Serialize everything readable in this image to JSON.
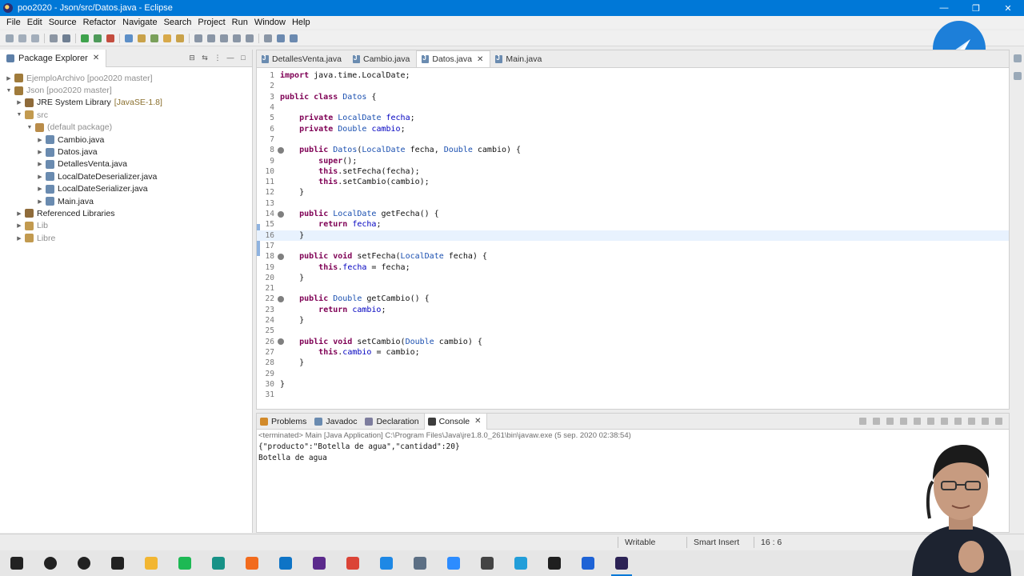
{
  "window": {
    "title": "poo2020 - Json/src/Datos.java - Eclipse",
    "min": "—",
    "restore": "❐",
    "close": "✕"
  },
  "menu": [
    "File",
    "Edit",
    "Source",
    "Refactor",
    "Navigate",
    "Search",
    "Project",
    "Run",
    "Window",
    "Help"
  ],
  "package_explorer": {
    "tab_label": "Package Explorer",
    "tree": [
      {
        "label": "EjemploArchivo [poo2020 master]",
        "depth": 0,
        "arrow": "▶",
        "dim": true,
        "icon_color": "#a07b3b"
      },
      {
        "label": "Json [poo2020 master]",
        "depth": 0,
        "arrow": "▼",
        "dim": true,
        "icon_color": "#a07b3b"
      },
      {
        "label": "JRE System Library",
        "extra": "[JavaSE-1.8]",
        "depth": 1,
        "arrow": "▶",
        "icon_color": "#8f6b3a"
      },
      {
        "label": "src",
        "depth": 1,
        "arrow": "▼",
        "dim": true,
        "icon_color": "#c29a4f"
      },
      {
        "label": "(default package)",
        "depth": 2,
        "arrow": "▼",
        "dim": true,
        "icon_color": "#b98c4a"
      },
      {
        "label": "Cambio.java",
        "depth": 3,
        "arrow": "▶",
        "icon_color": "#6a8bb0"
      },
      {
        "label": "Datos.java",
        "depth": 3,
        "arrow": "▶",
        "icon_color": "#6a8bb0"
      },
      {
        "label": "DetallesVenta.java",
        "depth": 3,
        "arrow": "▶",
        "icon_color": "#6a8bb0"
      },
      {
        "label": "LocalDateDeserializer.java",
        "depth": 3,
        "arrow": "▶",
        "icon_color": "#6a8bb0"
      },
      {
        "label": "LocalDateSerializer.java",
        "depth": 3,
        "arrow": "▶",
        "icon_color": "#6a8bb0"
      },
      {
        "label": "Main.java",
        "depth": 3,
        "arrow": "▶",
        "icon_color": "#6a8bb0"
      },
      {
        "label": "Referenced Libraries",
        "depth": 1,
        "arrow": "▶",
        "icon_color": "#8f6b3a"
      },
      {
        "label": "Lib",
        "depth": 1,
        "arrow": "▶",
        "dim": true,
        "icon_color": "#c29a4f"
      },
      {
        "label": "Libre",
        "depth": 1,
        "arrow": "▶",
        "dim": true,
        "icon_color": "#c29a4f"
      }
    ]
  },
  "editor": {
    "tabs": [
      {
        "label": "DetallesVenta.java",
        "active": false
      },
      {
        "label": "Cambio.java",
        "active": false
      },
      {
        "label": "Datos.java",
        "active": true
      },
      {
        "label": "Main.java",
        "active": false
      }
    ],
    "current_line": 16,
    "lines": [
      {
        "n": "1",
        "tokens": [
          [
            "kw",
            "import"
          ],
          [
            "t",
            " java.time.LocalDate;"
          ]
        ]
      },
      {
        "n": "2",
        "tokens": []
      },
      {
        "n": "3",
        "tokens": [
          [
            "kw",
            "public class"
          ],
          [
            "t",
            " "
          ],
          [
            "ty",
            "Datos"
          ],
          [
            "t",
            " {"
          ]
        ]
      },
      {
        "n": "4",
        "tokens": []
      },
      {
        "n": "5",
        "tokens": [
          [
            "t",
            "    "
          ],
          [
            "kw",
            "private"
          ],
          [
            "t",
            " "
          ],
          [
            "ty",
            "LocalDate"
          ],
          [
            "t",
            " "
          ],
          [
            "fld",
            "fecha"
          ],
          [
            "t",
            ";"
          ]
        ]
      },
      {
        "n": "6",
        "tokens": [
          [
            "t",
            "    "
          ],
          [
            "kw",
            "private"
          ],
          [
            "t",
            " "
          ],
          [
            "ty",
            "Double"
          ],
          [
            "t",
            " "
          ],
          [
            "fld",
            "cambio"
          ],
          [
            "t",
            ";"
          ]
        ]
      },
      {
        "n": "7",
        "tokens": []
      },
      {
        "n": "8",
        "mark": true,
        "tokens": [
          [
            "t",
            "    "
          ],
          [
            "kw",
            "public"
          ],
          [
            "t",
            " "
          ],
          [
            "ty",
            "Datos"
          ],
          [
            "t",
            "("
          ],
          [
            "ty",
            "LocalDate"
          ],
          [
            "t",
            " fecha, "
          ],
          [
            "ty",
            "Double"
          ],
          [
            "t",
            " cambio) {"
          ]
        ]
      },
      {
        "n": "9",
        "tokens": [
          [
            "t",
            "        "
          ],
          [
            "kw",
            "super"
          ],
          [
            "t",
            "();"
          ]
        ]
      },
      {
        "n": "10",
        "tokens": [
          [
            "t",
            "        "
          ],
          [
            "kw",
            "this"
          ],
          [
            "t",
            ".setFecha(fecha);"
          ]
        ]
      },
      {
        "n": "11",
        "tokens": [
          [
            "t",
            "        "
          ],
          [
            "kw",
            "this"
          ],
          [
            "t",
            ".setCambio(cambio);"
          ]
        ]
      },
      {
        "n": "12",
        "tokens": [
          [
            "t",
            "    }"
          ]
        ]
      },
      {
        "n": "13",
        "tokens": []
      },
      {
        "n": "14",
        "mark": true,
        "tokens": [
          [
            "t",
            "    "
          ],
          [
            "kw",
            "public"
          ],
          [
            "t",
            " "
          ],
          [
            "ty",
            "LocalDate"
          ],
          [
            "t",
            " getFecha() {"
          ]
        ]
      },
      {
        "n": "15",
        "tokens": [
          [
            "t",
            "        "
          ],
          [
            "kw",
            "return"
          ],
          [
            "t",
            " "
          ],
          [
            "fld",
            "fecha"
          ],
          [
            "t",
            ";"
          ]
        ]
      },
      {
        "n": "16",
        "tokens": [
          [
            "t",
            "    }"
          ]
        ]
      },
      {
        "n": "17",
        "tokens": []
      },
      {
        "n": "18",
        "mark": true,
        "tokens": [
          [
            "t",
            "    "
          ],
          [
            "kw",
            "public void"
          ],
          [
            "t",
            " setFecha("
          ],
          [
            "ty",
            "LocalDate"
          ],
          [
            "t",
            " fecha) {"
          ]
        ]
      },
      {
        "n": "19",
        "tokens": [
          [
            "t",
            "        "
          ],
          [
            "kw",
            "this"
          ],
          [
            "t",
            "."
          ],
          [
            "fld",
            "fecha"
          ],
          [
            "t",
            " = fecha;"
          ]
        ]
      },
      {
        "n": "20",
        "tokens": [
          [
            "t",
            "    }"
          ]
        ]
      },
      {
        "n": "21",
        "tokens": []
      },
      {
        "n": "22",
        "mark": true,
        "tokens": [
          [
            "t",
            "    "
          ],
          [
            "kw",
            "public"
          ],
          [
            "t",
            " "
          ],
          [
            "ty",
            "Double"
          ],
          [
            "t",
            " getCambio() {"
          ]
        ]
      },
      {
        "n": "23",
        "tokens": [
          [
            "t",
            "        "
          ],
          [
            "kw",
            "return"
          ],
          [
            "t",
            " "
          ],
          [
            "fld",
            "cambio"
          ],
          [
            "t",
            ";"
          ]
        ]
      },
      {
        "n": "24",
        "tokens": [
          [
            "t",
            "    }"
          ]
        ]
      },
      {
        "n": "25",
        "tokens": []
      },
      {
        "n": "26",
        "mark": true,
        "tokens": [
          [
            "t",
            "    "
          ],
          [
            "kw",
            "public void"
          ],
          [
            "t",
            " setCambio("
          ],
          [
            "ty",
            "Double"
          ],
          [
            "t",
            " cambio) {"
          ]
        ]
      },
      {
        "n": "27",
        "tokens": [
          [
            "t",
            "        "
          ],
          [
            "kw",
            "this"
          ],
          [
            "t",
            "."
          ],
          [
            "fld",
            "cambio"
          ],
          [
            "t",
            " = cambio;"
          ]
        ]
      },
      {
        "n": "28",
        "tokens": [
          [
            "t",
            "    }"
          ]
        ]
      },
      {
        "n": "29",
        "tokens": []
      },
      {
        "n": "30",
        "tokens": [
          [
            "t",
            "}"
          ]
        ]
      },
      {
        "n": "31",
        "tokens": []
      }
    ]
  },
  "bottom": {
    "tabs": [
      {
        "label": "Problems",
        "active": false,
        "icon_color": "#d28a2a"
      },
      {
        "label": "Javadoc",
        "active": false,
        "icon_color": "#6a8bb0"
      },
      {
        "label": "Declaration",
        "active": false,
        "icon_color": "#7d7d9e"
      },
      {
        "label": "Console",
        "active": true,
        "icon_color": "#3d3d3d"
      }
    ],
    "console_status": "<terminated> Main [Java Application] C:\\Program Files\\Java\\jre1.8.0_261\\bin\\javaw.exe (5 sep. 2020 02:38:54)",
    "console_lines": [
      "{\"producto\":\"Botella de agua\",\"cantidad\":20}",
      "Botella de agua"
    ]
  },
  "status": {
    "writable": "Writable",
    "insert_mode": "Smart Insert",
    "position": "16 : 6"
  },
  "taskbar": {
    "icons": [
      {
        "name": "windows-start-icon",
        "color": "#222222"
      },
      {
        "name": "search-icon",
        "color": "#222222"
      },
      {
        "name": "cortana-icon",
        "color": "#222222"
      },
      {
        "name": "task-view-icon",
        "color": "#222222"
      },
      {
        "name": "file-explorer-icon",
        "color": "#f2b632"
      },
      {
        "name": "spotify-icon",
        "color": "#1db954"
      },
      {
        "name": "gitkraken-icon",
        "color": "#179287"
      },
      {
        "name": "sublime-icon",
        "color": "#f26b1d"
      },
      {
        "name": "vscode-icon",
        "color": "#0e74c6"
      },
      {
        "name": "premiere-icon",
        "color": "#5b2a8c"
      },
      {
        "name": "chrome-icon",
        "color": "#db4437"
      },
      {
        "name": "edge-icon",
        "color": "#1e88e5"
      },
      {
        "name": "network-icon",
        "color": "#5c6f84"
      },
      {
        "name": "zoom-icon",
        "color": "#2d8cff"
      },
      {
        "name": "settings-icon",
        "color": "#444444"
      },
      {
        "name": "telegram-icon",
        "color": "#229ed9"
      },
      {
        "name": "terminal-icon",
        "color": "#1f1f1f"
      },
      {
        "name": "maps-icon",
        "color": "#1e63d6"
      },
      {
        "name": "eclipse-icon",
        "color": "#2c2255"
      }
    ]
  }
}
